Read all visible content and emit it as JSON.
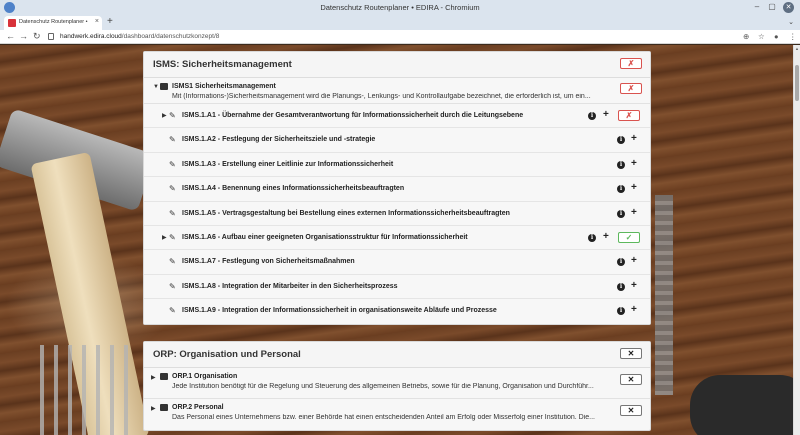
{
  "window": {
    "title": "Datenschutz Routenplaner • EDIRA - Chromium"
  },
  "tab": {
    "title": "Datenschutz Routenplaner • EDIRA",
    "close": "×",
    "new": "+"
  },
  "toolbar": {
    "back": "←",
    "forward": "→",
    "reload": "↻",
    "url_host": "handwerk.edira.cloud",
    "url_path": "/dashboard/datenschutzkonzept/8"
  },
  "glyphs": {
    "minimize": "‒",
    "maximize": "▢",
    "close": "✕",
    "caret_down": "▼",
    "caret_right": "▶",
    "edit": "✎",
    "info": "i",
    "plus": "+",
    "remove": "✗",
    "check": "✓",
    "cross": "✕",
    "zoom": "⊕",
    "star": "☆",
    "menu": "⋮",
    "account": "●",
    "search": "⌄"
  },
  "cards": [
    {
      "title": "ISMS: Sicherheitsmanagement",
      "module": {
        "title": "ISMS1 Sicherheitsmanagement",
        "description": "Mit (Informations-)Sicherheitsmanagement wird die Planungs-, Lenkungs- und Kontrollaufgabe bezeichnet, die erforderlich ist, um ein..."
      },
      "requirements": [
        {
          "title": "ISMS.1.A1 - Übernahme der Gesamtverantwortung für Informationssicherheit durch die Leitungsebene"
        },
        {
          "title": "ISMS.1.A2 - Festlegung der Sicherheitsziele und -strategie"
        },
        {
          "title": "ISMS.1.A3 - Erstellung einer Leitlinie zur Informationssicherheit"
        },
        {
          "title": "ISMS.1.A4 - Benennung eines Informationssicherheitsbeauftragten"
        },
        {
          "title": "ISMS.1.A5 - Vertragsgestaltung bei Bestellung eines externen Informationssicherheitsbeauftragten"
        },
        {
          "title": "ISMS.1.A6 - Aufbau einer geeigneten Organisationsstruktur für Informationssicherheit"
        },
        {
          "title": "ISMS.1.A7 - Festlegung von Sicherheitsmaßnahmen"
        },
        {
          "title": "ISMS.1.A8 - Integration der Mitarbeiter in den Sicherheitsprozess"
        },
        {
          "title": "ISMS.1.A9 - Integration der Informationssicherheit in organisationsweite Abläufe und Prozesse"
        }
      ]
    },
    {
      "title": "ORP: Organisation und Personal",
      "modules": [
        {
          "title": "ORP.1 Organisation",
          "description": "Jede Institution benötigt für die Regelung und Steuerung des allgemeinen Betriebs, sowie für die Planung, Organisation und Durchführ..."
        },
        {
          "title": "ORP.2 Personal",
          "description": "Das Personal eines Unternehmens bzw. einer Behörde hat einen entscheidenden Anteil am Erfolg oder Misserfolg einer Institution. Die..."
        }
      ]
    }
  ],
  "colors": {
    "red": "#d9534f",
    "green": "#5cb85c",
    "card_bg": "#f7f7f7"
  }
}
